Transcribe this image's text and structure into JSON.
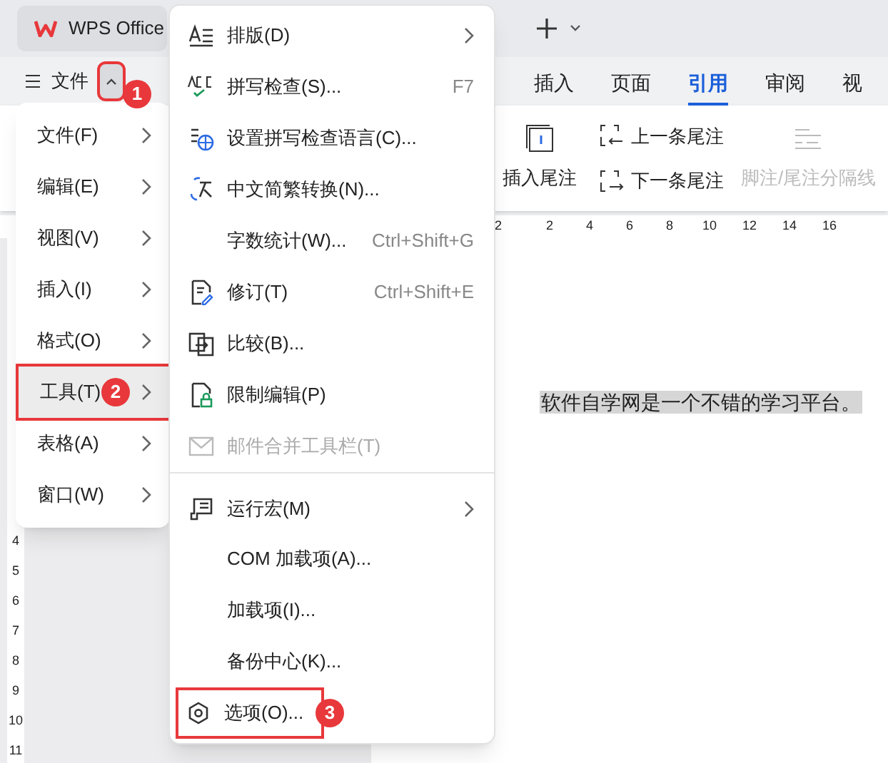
{
  "app": {
    "title": "WPS Office"
  },
  "toolbar": {
    "menu_label": "文件",
    "collapse_step": "1",
    "tabs": [
      {
        "label": "插入",
        "selected": false
      },
      {
        "label": "页面",
        "selected": false
      },
      {
        "label": "引用",
        "selected": true
      },
      {
        "label": "审阅",
        "selected": false
      },
      {
        "label": "视",
        "selected": false
      }
    ]
  },
  "ribbon": {
    "buttons": [
      {
        "label": "插入尾注",
        "disabled": false
      },
      {
        "label": "上一条尾注",
        "disabled": false
      },
      {
        "label": "下一条尾注",
        "disabled": false
      },
      {
        "label": "脚注/尾注分隔线",
        "disabled": true
      }
    ]
  },
  "ruler": {
    "ticks": [
      "2",
      "2",
      "4",
      "6",
      "8",
      "10",
      "12",
      "14",
      "16"
    ]
  },
  "vertical_ruler": {
    "ticks": [
      "4",
      "5",
      "6",
      "7",
      "8",
      "9",
      "10",
      "11"
    ]
  },
  "document": {
    "text": "软件自学网是一个不错的学习平台。"
  },
  "main_menu": {
    "items": [
      {
        "label": "文件(F)",
        "selected": false
      },
      {
        "label": "编辑(E)",
        "selected": false
      },
      {
        "label": "视图(V)",
        "selected": false
      },
      {
        "label": "插入(I)",
        "selected": false
      },
      {
        "label": "格式(O)",
        "selected": false
      },
      {
        "label": "工具(T)",
        "selected": true,
        "step": "2"
      },
      {
        "label": "表格(A)",
        "selected": false
      },
      {
        "label": "窗口(W)",
        "selected": false
      }
    ]
  },
  "tools_menu": {
    "items": [
      {
        "label": "排版(D)",
        "submenu": true,
        "disabled": false,
        "separator_before": false
      },
      {
        "label": "拼写检查(S)...",
        "shortcut": "F7",
        "submenu": false,
        "disabled": false,
        "separator_before": false
      },
      {
        "label": "设置拼写检查语言(C)...",
        "submenu": false,
        "disabled": false,
        "separator_before": false
      },
      {
        "label": "中文简繁转换(N)...",
        "submenu": false,
        "disabled": false,
        "separator_before": false
      },
      {
        "label": "字数统计(W)...",
        "shortcut": "Ctrl+Shift+G",
        "submenu": false,
        "disabled": false,
        "separator_before": false
      },
      {
        "label": "修订(T)",
        "shortcut": "Ctrl+Shift+E",
        "submenu": false,
        "disabled": false,
        "separator_before": false
      },
      {
        "label": "比较(B)...",
        "submenu": false,
        "disabled": false,
        "separator_before": false
      },
      {
        "label": "限制编辑(P)",
        "submenu": false,
        "disabled": false,
        "separator_before": false
      },
      {
        "label": "邮件合并工具栏(T)",
        "submenu": false,
        "disabled": true,
        "separator_before": false
      },
      {
        "label": "运行宏(M)",
        "submenu": true,
        "disabled": false,
        "separator_before": true
      },
      {
        "label": "COM 加载项(A)...",
        "submenu": false,
        "disabled": false,
        "separator_before": false
      },
      {
        "label": "加载项(I)...",
        "submenu": false,
        "disabled": false,
        "separator_before": false
      },
      {
        "label": "备份中心(K)...",
        "submenu": false,
        "disabled": false,
        "separator_before": false
      },
      {
        "label": "选项(O)...",
        "step": "3",
        "submenu": false,
        "disabled": false,
        "separator_before": false
      }
    ]
  }
}
